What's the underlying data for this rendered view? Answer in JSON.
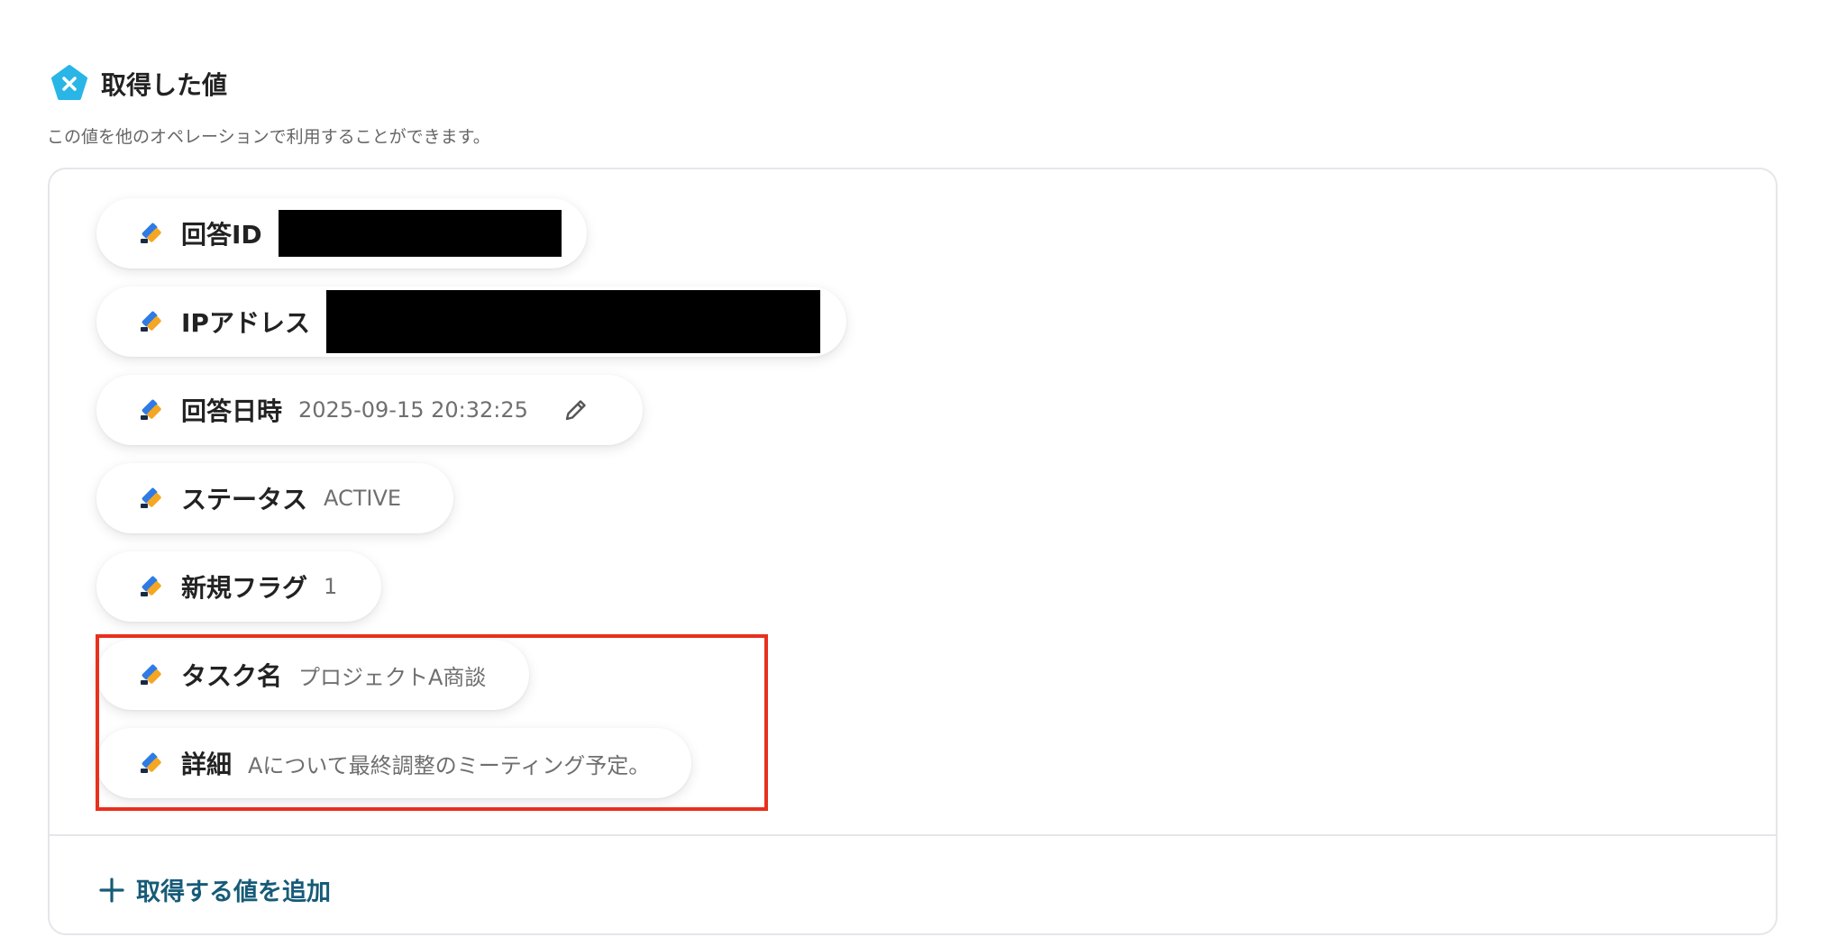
{
  "section": {
    "title": "取得した値",
    "description": "この値を他のオペレーションで利用することができます。",
    "header_icon": "variable-x-icon",
    "accent_color": "#29b6e6"
  },
  "fields": [
    {
      "label": "回答ID",
      "value": "",
      "redacted": true
    },
    {
      "label": "IPアドレス",
      "value": "",
      "redacted": true
    },
    {
      "label": "回答日時",
      "value": "2025-09-15 20:32:25",
      "editable": true
    },
    {
      "label": "ステータス",
      "value": "ACTIVE"
    },
    {
      "label": "新規フラグ",
      "value": "1"
    },
    {
      "label": "タスク名",
      "value": "プロジェクトA商談",
      "highlighted": true
    },
    {
      "label": "詳細",
      "value": "Aについて最終調整のミーティング予定。",
      "highlighted": true
    }
  ],
  "field_icon": "form-app-icon",
  "add_button": {
    "label": "取得する値を追加",
    "icon": "plus-icon",
    "color": "#175b78"
  },
  "highlight_color": "#e8301e"
}
